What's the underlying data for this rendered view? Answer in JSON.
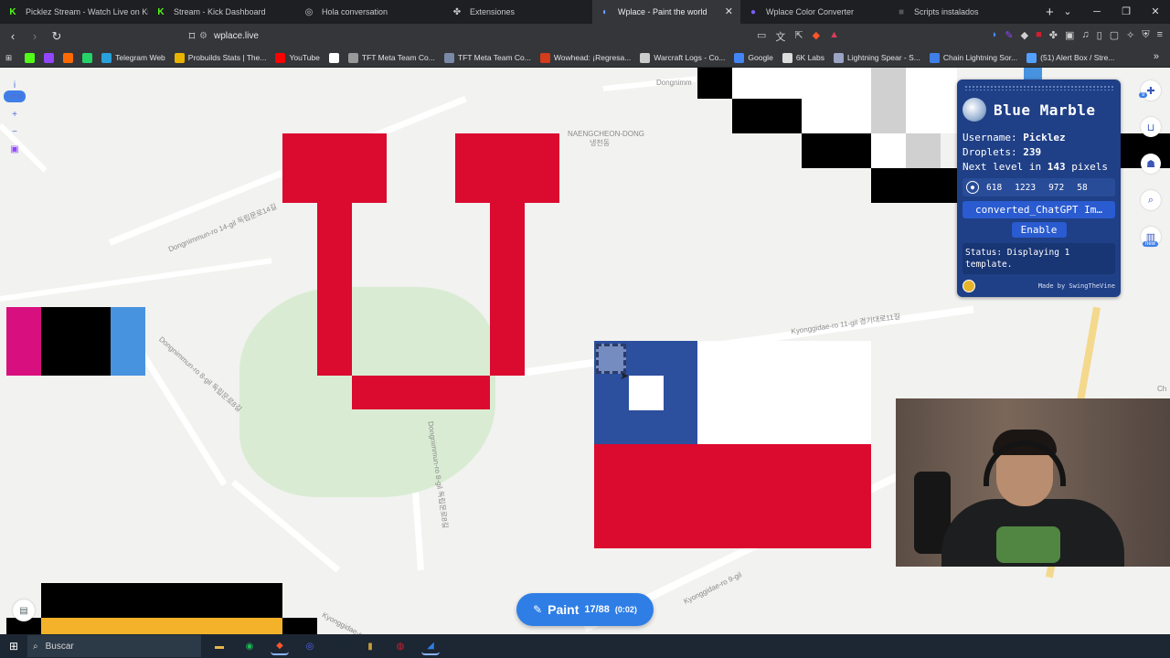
{
  "browser": {
    "tabs": [
      {
        "title": "Picklez Stream - Watch Live on Kick",
        "icon": "kick-icon",
        "color": "#53fc18",
        "active": false
      },
      {
        "title": "Stream - Kick Dashboard",
        "icon": "kick-icon",
        "color": "#53fc18",
        "active": false
      },
      {
        "title": "Hola conversation",
        "icon": "chat-icon",
        "color": "#cccccc",
        "active": false
      },
      {
        "title": "Extensiones",
        "icon": "puzzle-icon",
        "color": "#cccccc",
        "active": false
      },
      {
        "title": "Wplace - Paint the world",
        "icon": "globe-icon",
        "color": "#6aa6ff",
        "active": true
      },
      {
        "title": "Wplace Color Converter",
        "icon": "palette-icon",
        "color": "#7c5cff",
        "active": false
      },
      {
        "title": "Scripts instalados",
        "icon": "script-icon",
        "color": "#333333",
        "active": false
      }
    ],
    "url": "wplace.live",
    "bookmarks": [
      {
        "label": "",
        "color": "#53fc18"
      },
      {
        "label": "",
        "color": "#9146ff"
      },
      {
        "label": "",
        "color": "#ff6a00"
      },
      {
        "label": "",
        "color": "#25d366"
      },
      {
        "label": "Telegram Web",
        "color": "#2aa1da"
      },
      {
        "label": "Probuilds Stats | The...",
        "color": "#e8b400"
      },
      {
        "label": "YouTube",
        "color": "#ff0000"
      },
      {
        "label": "",
        "color": "#ffffff"
      },
      {
        "label": "TFT Meta Team Co...",
        "color": "#999999"
      },
      {
        "label": "TFT Meta Team Co...",
        "color": "#7a8aa6"
      },
      {
        "label": "Wowhead: ¡Regresa...",
        "color": "#d43c1c"
      },
      {
        "label": "Warcraft Logs - Co...",
        "color": "#cccccc"
      },
      {
        "label": "Google",
        "color": "#4285f4"
      },
      {
        "label": "6K Labs",
        "color": "#dddddd"
      },
      {
        "label": "Lightning Spear - S...",
        "color": "#9aa4c4"
      },
      {
        "label": "Chain Lightning Sor...",
        "color": "#3f7fe8"
      },
      {
        "label": "(51) Alert Box / Stre...",
        "color": "#53a0ff"
      }
    ]
  },
  "map_labels": {
    "district": "NAENGCHEON-DONG",
    "district_kr": "냉천동",
    "road1": "Dongnimmun-ro 14-gil 독립문로14길",
    "road2": "Dongnimmun-ro 8-gil 독립문로8길",
    "road3": "Dongnimmun-ro 8-gil 독립문로8길",
    "road4": "Kyonggidae-ro 11-gil 경기대로11길",
    "road5": "Kyonggidae-ro 9-gil",
    "road6": "Kyonggidae-ro",
    "road7": "Dongnimm",
    "road8": "Ch"
  },
  "blue_marble": {
    "title": "Blue Marble",
    "username_label": "Username:",
    "username": "Picklez",
    "droplets_label": "Droplets:",
    "droplets": "239",
    "next_level_prefix": "Next level in",
    "next_level_pixels": "143",
    "next_level_suffix": "pixels",
    "coords": [
      "618",
      "1223",
      "972",
      "58"
    ],
    "template_file": "converted_ChatGPT Im…",
    "enable_label": "Enable",
    "status": "Status: Displaying 1 template.",
    "made_by": "Made by SwingTheVine"
  },
  "paint_button": {
    "label": "Paint",
    "count": "17/88",
    "timer": "(0:02)"
  },
  "taskbar": {
    "search_placeholder": "Buscar",
    "apps": [
      {
        "name": "file-explorer-icon",
        "color": "#e8b64a"
      },
      {
        "name": "spotify-icon",
        "color": "#1db954"
      },
      {
        "name": "brave-icon",
        "color": "#fb542b"
      },
      {
        "name": "discord-icon",
        "color": "#5865f2"
      },
      {
        "name": "steam-icon",
        "color": "#1b2838"
      },
      {
        "name": "obs-like-icon",
        "color": "#c89b3c"
      },
      {
        "name": "record-icon",
        "color": "#d01f2f"
      },
      {
        "name": "paint-app-icon",
        "color": "#2f7ee6"
      }
    ]
  },
  "colors": {
    "red": "#db0a2f",
    "blue": "#2c4f9e",
    "white": "#ffffff",
    "black": "#000000",
    "magenta": "#d8107f",
    "sky": "#4793e0",
    "gold": "#f3b22a",
    "grey": "#d0d0d0"
  }
}
